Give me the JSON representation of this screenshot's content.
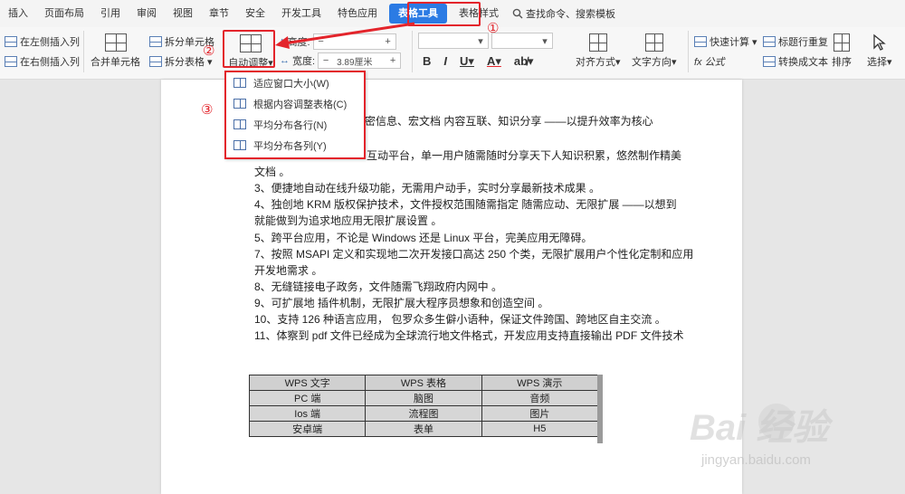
{
  "menu": {
    "items": [
      "插入",
      "页面布局",
      "引用",
      "审阅",
      "视图",
      "章节",
      "安全",
      "开发工具",
      "特色应用"
    ],
    "active": "表格工具",
    "after": "表格样式",
    "search": "查找命令、搜索模板"
  },
  "ribbon": {
    "insert_left": "在左侧插入列",
    "insert_right": "在右侧插入列",
    "merge": "合并单元格",
    "split_cell": "拆分单元格",
    "split_table": "拆分表格",
    "auto_adjust": "自动调整",
    "height_label": "高度:",
    "width_label": "宽度:",
    "width_value": "3.89厘米",
    "align": "对齐方式",
    "text_dir": "文字方向",
    "quick_calc": "快速计算",
    "formula": "fx 公式",
    "title_repeat": "标题行重复",
    "to_text": "转换成文本",
    "sort": "排序",
    "select": "选择"
  },
  "dropdown": {
    "items": [
      "适应窗口大小(W)",
      "根据内容调整表格(C)",
      "平均分布各行(N)",
      "平均分布各列(Y)"
    ]
  },
  "steps": [
    "①",
    "②",
    "③"
  ],
  "doc": {
    "lines": [
      "ce 加密信息、宏文档  内容互联、知识分享  ——以提升效率为核心",
      "互动平台，单一用户随需随时分享天下人知识积累，悠然制作精美",
      "文档 。",
      "3、便捷地自动在线升级功能，无需用户动手，实时分享最新技术成果 。",
      "4、独创地 KRM 版权保护技术，文件授权范围随需指定  随需应动、无限扩展 ——以想到",
      "就能做到为追求地应用无限扩展设置 。",
      "5、跨平台应用，不论是  Windows 还是  Linux 平台，完美应用无障碍。",
      "7、按照 MSAPI 定义和实现地二次开发接口高达 250 个类，无限扩展用户个性化定制和应用",
      "开发地需求 。",
      "8、无缝链接电子政务，文件随需飞翔政府内网中 。",
      "9、可扩展地  插件机制，无限扩展大程序员想象和创造空间 。",
      "10、支持 126 种语言应用，  包罗众多生僻小语种，保证文件跨国、跨地区自主交流 。",
      "11、体察到  pdf 文件已经成为全球流行地文件格式，开发应用支持直接输出  PDF 文件技术"
    ],
    "table": [
      [
        "WPS 文字",
        "WPS 表格",
        "WPS 演示"
      ],
      [
        "PC 端",
        "脑图",
        "音频"
      ],
      [
        "Ios 端",
        "流程图",
        "图片"
      ],
      [
        "安卓端",
        "表单",
        "H5"
      ]
    ]
  },
  "watermark": {
    "brand": "Bai 经验",
    "url": "jingyan.baidu.com"
  },
  "colors": {
    "accent": "#2b7be4",
    "highlight": "#e3242b"
  }
}
